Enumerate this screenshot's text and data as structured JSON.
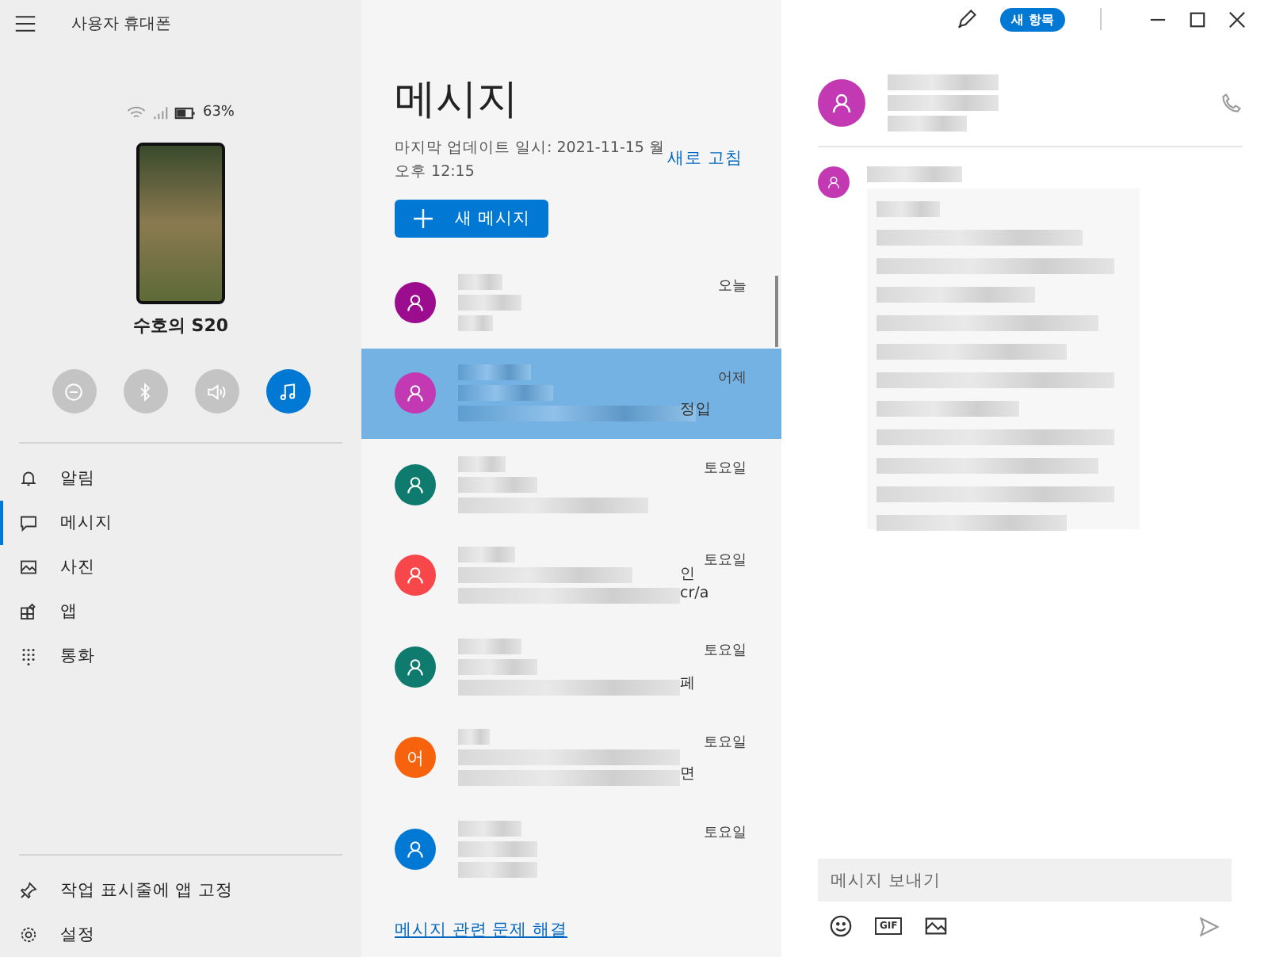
{
  "window": {
    "title": "사용자 휴대폰",
    "badge": "새 항목"
  },
  "phone": {
    "battery": "63%",
    "name": "수호의 S20"
  },
  "quick_actions": [
    {
      "kind": "dnd",
      "on": false
    },
    {
      "kind": "bluetooth",
      "on": false
    },
    {
      "kind": "sound",
      "on": false
    },
    {
      "kind": "music",
      "on": true
    }
  ],
  "nav": [
    {
      "kind": "bell",
      "label": "알림",
      "selected": false
    },
    {
      "kind": "chat",
      "label": "메시지",
      "selected": true
    },
    {
      "kind": "photo",
      "label": "사진",
      "selected": false
    },
    {
      "kind": "apps",
      "label": "앱",
      "selected": false
    },
    {
      "kind": "dialpad",
      "label": "통화",
      "selected": false
    }
  ],
  "sidebar_footer": [
    {
      "kind": "pin",
      "label": "작업 표시줄에 앱 고정"
    },
    {
      "kind": "gear",
      "label": "설정"
    }
  ],
  "messages": {
    "title": "메시지",
    "updated": "마지막 업데이트 일시: 2021-11-15 월 오후 12:15",
    "refresh": "새로 고침",
    "new_button": "새 메시지",
    "help_link": "메시지 관련 문제 해결",
    "conversations": [
      {
        "color": "#9b0d8e",
        "time": "오늘",
        "selected": false
      },
      {
        "color": "#c239b3",
        "time": "어제",
        "selected": true,
        "tail": [
          "정입"
        ]
      },
      {
        "color": "#0f7b6f",
        "time": "토요일",
        "selected": false
      },
      {
        "color": "#f7474b",
        "time": "토요일",
        "selected": false,
        "tail": [
          "인",
          "cr/a"
        ]
      },
      {
        "color": "#0f7b6f",
        "time": "토요일",
        "selected": false,
        "tail": [
          "페"
        ]
      },
      {
        "color": "#f7630c",
        "letter": "어",
        "time": "토요일",
        "selected": false,
        "tail": [
          "면"
        ]
      },
      {
        "color": "#0078d4",
        "time": "토요일",
        "selected": false
      }
    ]
  },
  "conversation": {
    "color": "#c239b3",
    "compose": {
      "placeholder": "메시지 보내기"
    },
    "gif_label": "GIF"
  }
}
